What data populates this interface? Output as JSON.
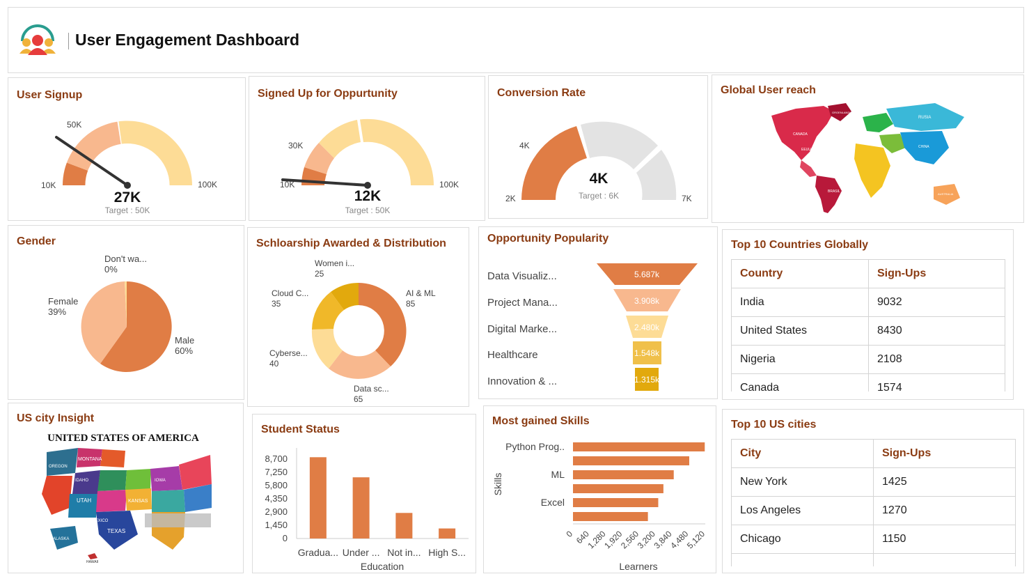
{
  "header": {
    "title": "User Engagement Dashboard",
    "logo_icon": "user-group-icon"
  },
  "colors": {
    "dark_orange": "#e07d45",
    "light_orange": "#f8b88e",
    "pale_yellow": "#fddc96",
    "amber": "#f0c04a",
    "gold": "#e2a90d",
    "gray": "#e3e3e3",
    "title_brown": "#8a3b12"
  },
  "signup": {
    "title": "User Signup",
    "value": "27K",
    "target": "Target : 50K",
    "min": "10K",
    "mid": "50K",
    "max": "100K",
    "needle_fraction": 0.19
  },
  "opportunity": {
    "title": "Signed Up for Oppurtunity",
    "value": "12K",
    "target": "Target : 50K",
    "min": "10K",
    "mid": "30K",
    "max": "100K",
    "needle_fraction": 0.02
  },
  "conversion": {
    "title": "Conversion Rate",
    "value": "4K",
    "target": "Target : 6K",
    "min": "2K",
    "mid": "4K",
    "max": "7K",
    "fill_fraction": 0.4
  },
  "reach": {
    "title": "Global User reach",
    "labels": [
      "CANADA",
      "EEUU",
      "BRASIL",
      "RUSIA",
      "CHINA",
      "AUSTRALIA",
      "GROENLANDIA"
    ]
  },
  "gender": {
    "title": "Gender",
    "labels": [
      {
        "name": "Don't wa...",
        "pct": "0%"
      },
      {
        "name": "Female",
        "pct": "39%"
      },
      {
        "name": "Male",
        "pct": "60%"
      }
    ]
  },
  "scholarship": {
    "title": "Schloarship Awarded & Distribution",
    "labels": [
      {
        "name": "Women i...",
        "val": "25"
      },
      {
        "name": "AI & ML",
        "val": "85"
      },
      {
        "name": "Cloud C...",
        "val": "35"
      },
      {
        "name": "Cyberse...",
        "val": "40"
      },
      {
        "name": "Data sc...",
        "val": "65"
      }
    ]
  },
  "popularity": {
    "title": "Opportunity Popularity",
    "items": [
      {
        "label": "Data Visualiz...",
        "value": "5.687k"
      },
      {
        "label": "Project Mana...",
        "value": "3.908k"
      },
      {
        "label": "Digital Marke...",
        "value": "2.480k"
      },
      {
        "label": "Healthcare",
        "value": "1.548k"
      },
      {
        "label": "Innovation & ...",
        "value": "1.315k"
      }
    ]
  },
  "countries": {
    "title": "Top 10 Countries Globally",
    "headers": [
      "Country",
      "Sign-Ups"
    ],
    "rows": [
      [
        "India",
        "9032"
      ],
      [
        "United States",
        "8430"
      ],
      [
        "Nigeria",
        "2108"
      ],
      [
        "Canada",
        "1574"
      ]
    ]
  },
  "uscity": {
    "title": "US city Insight",
    "map_title": "UNITED STATES OF AMERICA",
    "states": [
      "MONTANA",
      "OREGON",
      "IDAHO",
      "UTAH",
      "TEXAS",
      "KANSAS",
      "IOWA",
      "NEW MEXICO",
      "ALASKA",
      "HAWAII"
    ]
  },
  "student": {
    "title": "Student Status"
  },
  "skills": {
    "title": "Most gained Skills"
  },
  "uscities": {
    "title": "Top 10 US cities",
    "headers": [
      "City",
      "Sign-Ups"
    ],
    "rows": [
      [
        "New York",
        "1425"
      ],
      [
        "Los Angeles",
        "1270"
      ],
      [
        "Chicago",
        "1150"
      ],
      [
        "",
        ""
      ]
    ]
  },
  "chart_data": [
    {
      "type": "bar",
      "title": "Student Status",
      "categories": [
        "Gradua...",
        "Under ...",
        "Not in...",
        "High S..."
      ],
      "values": [
        8900,
        6700,
        2800,
        1100
      ],
      "xlabel": "Education",
      "ylabel": "",
      "yticks": [
        "8,700",
        "7,250",
        "5,800",
        "4,350",
        "2,900",
        "1,450",
        "0"
      ],
      "ylim": [
        0,
        9000
      ]
    },
    {
      "type": "bar",
      "orientation": "horizontal",
      "title": "Most gained Skills",
      "categories": [
        "Python Prog..",
        "",
        "ML",
        "",
        "Excel",
        ""
      ],
      "values": [
        5100,
        4500,
        3900,
        3500,
        3300,
        2900
      ],
      "xlabel": "Learners",
      "ylabel": "Skills",
      "xticks": [
        "0",
        "640",
        "1,280",
        "1,920",
        "2,560",
        "3,200",
        "3,840",
        "4,480",
        "5,120"
      ],
      "xlim": [
        0,
        5120
      ]
    }
  ]
}
